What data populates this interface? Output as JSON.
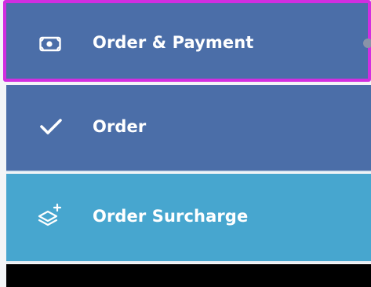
{
  "menu": {
    "header": {
      "label": "Order & Payment",
      "icon": "money-bill-icon"
    },
    "items": [
      {
        "label": "Order",
        "icon": "checkmark-icon"
      },
      {
        "label": "Order Surcharge",
        "icon": "layers-plus-icon"
      }
    ]
  },
  "colors": {
    "header_bg": "#4b6ea8",
    "selected_outline": "#d12ee0",
    "order_bg": "#4b6ea8",
    "surcharge_bg": "#47a6cf",
    "text": "#ffffff"
  }
}
